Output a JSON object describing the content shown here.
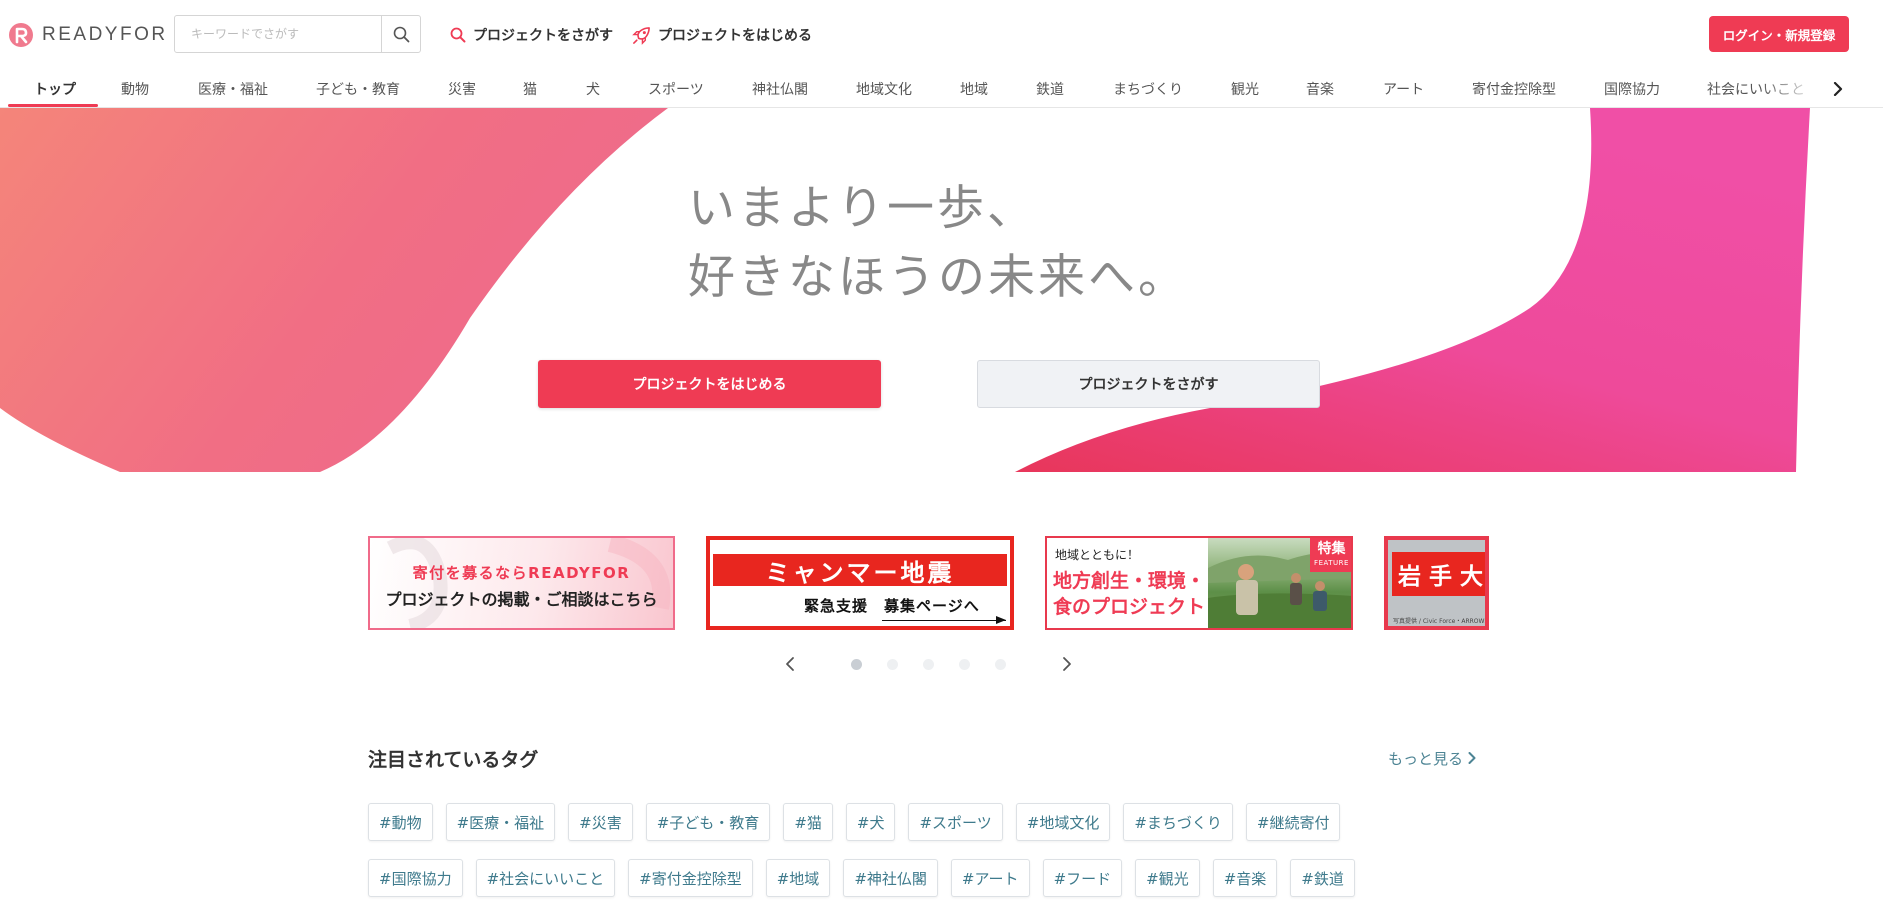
{
  "header": {
    "logo_text": "READYFOR",
    "search": {
      "placeholder": "キーワードでさがす",
      "value": ""
    },
    "nav_find": "プロジェクトをさがす",
    "nav_start": "プロジェクトをはじめる",
    "login_label": "ログイン・新規登録"
  },
  "categories": [
    "トップ",
    "動物",
    "医療・福祉",
    "子ども・教育",
    "災害",
    "猫",
    "犬",
    "スポーツ",
    "神社仏閣",
    "地域文化",
    "地域",
    "鉄道",
    "まちづくり",
    "観光",
    "音楽",
    "アート",
    "寄付金控除型",
    "国際協力",
    "社会にいいこと"
  ],
  "hero": {
    "line1": "いまより一歩、",
    "line2": "好きなほうの未来へ。",
    "primary_button": "プロジェクトをはじめる",
    "secondary_button": "プロジェクトをさがす"
  },
  "banners": {
    "b1_line1": "寄付を募るならREADYFOR",
    "b1_line2": "プロジェクトの掲載・ご相談はこちら",
    "b2_title": "ミャンマー地震",
    "b2_sub": "緊急支援　募集ページへ",
    "b3_small": "地域とともに！",
    "b3_big": "地方創生・環境・\n食のプロジェクト",
    "b3_tag": "特集",
    "b3_tag_small": "FEATURE",
    "b4_text": "岩手大",
    "b4_credit": "写真提供 / Civic Force・ARROWS"
  },
  "carousel": {
    "dots": 5,
    "active": 1
  },
  "tags_section": {
    "title": "注目されているタグ",
    "more": "もっと見る",
    "row1": [
      "#動物",
      "#医療・福祉",
      "#災害",
      "#子ども・教育",
      "#猫",
      "#犬",
      "#スポーツ",
      "#地域文化",
      "#まちづくり",
      "#継続寄付"
    ],
    "row2": [
      "#国際協力",
      "#社会にいいこと",
      "#寄付金控除型",
      "#地域",
      "#神社仏閣",
      "#アート",
      "#フード",
      "#観光",
      "#音楽",
      "#鉄道"
    ]
  },
  "colors": {
    "brand": "#ef3b54",
    "tag_text": "#3e7a8c",
    "hero_text": "#888888"
  },
  "icons": [
    "readyfor-logo-icon",
    "search-icon",
    "search-red-icon",
    "rocket-icon",
    "chevron-right-icon",
    "chevron-left-icon"
  ]
}
